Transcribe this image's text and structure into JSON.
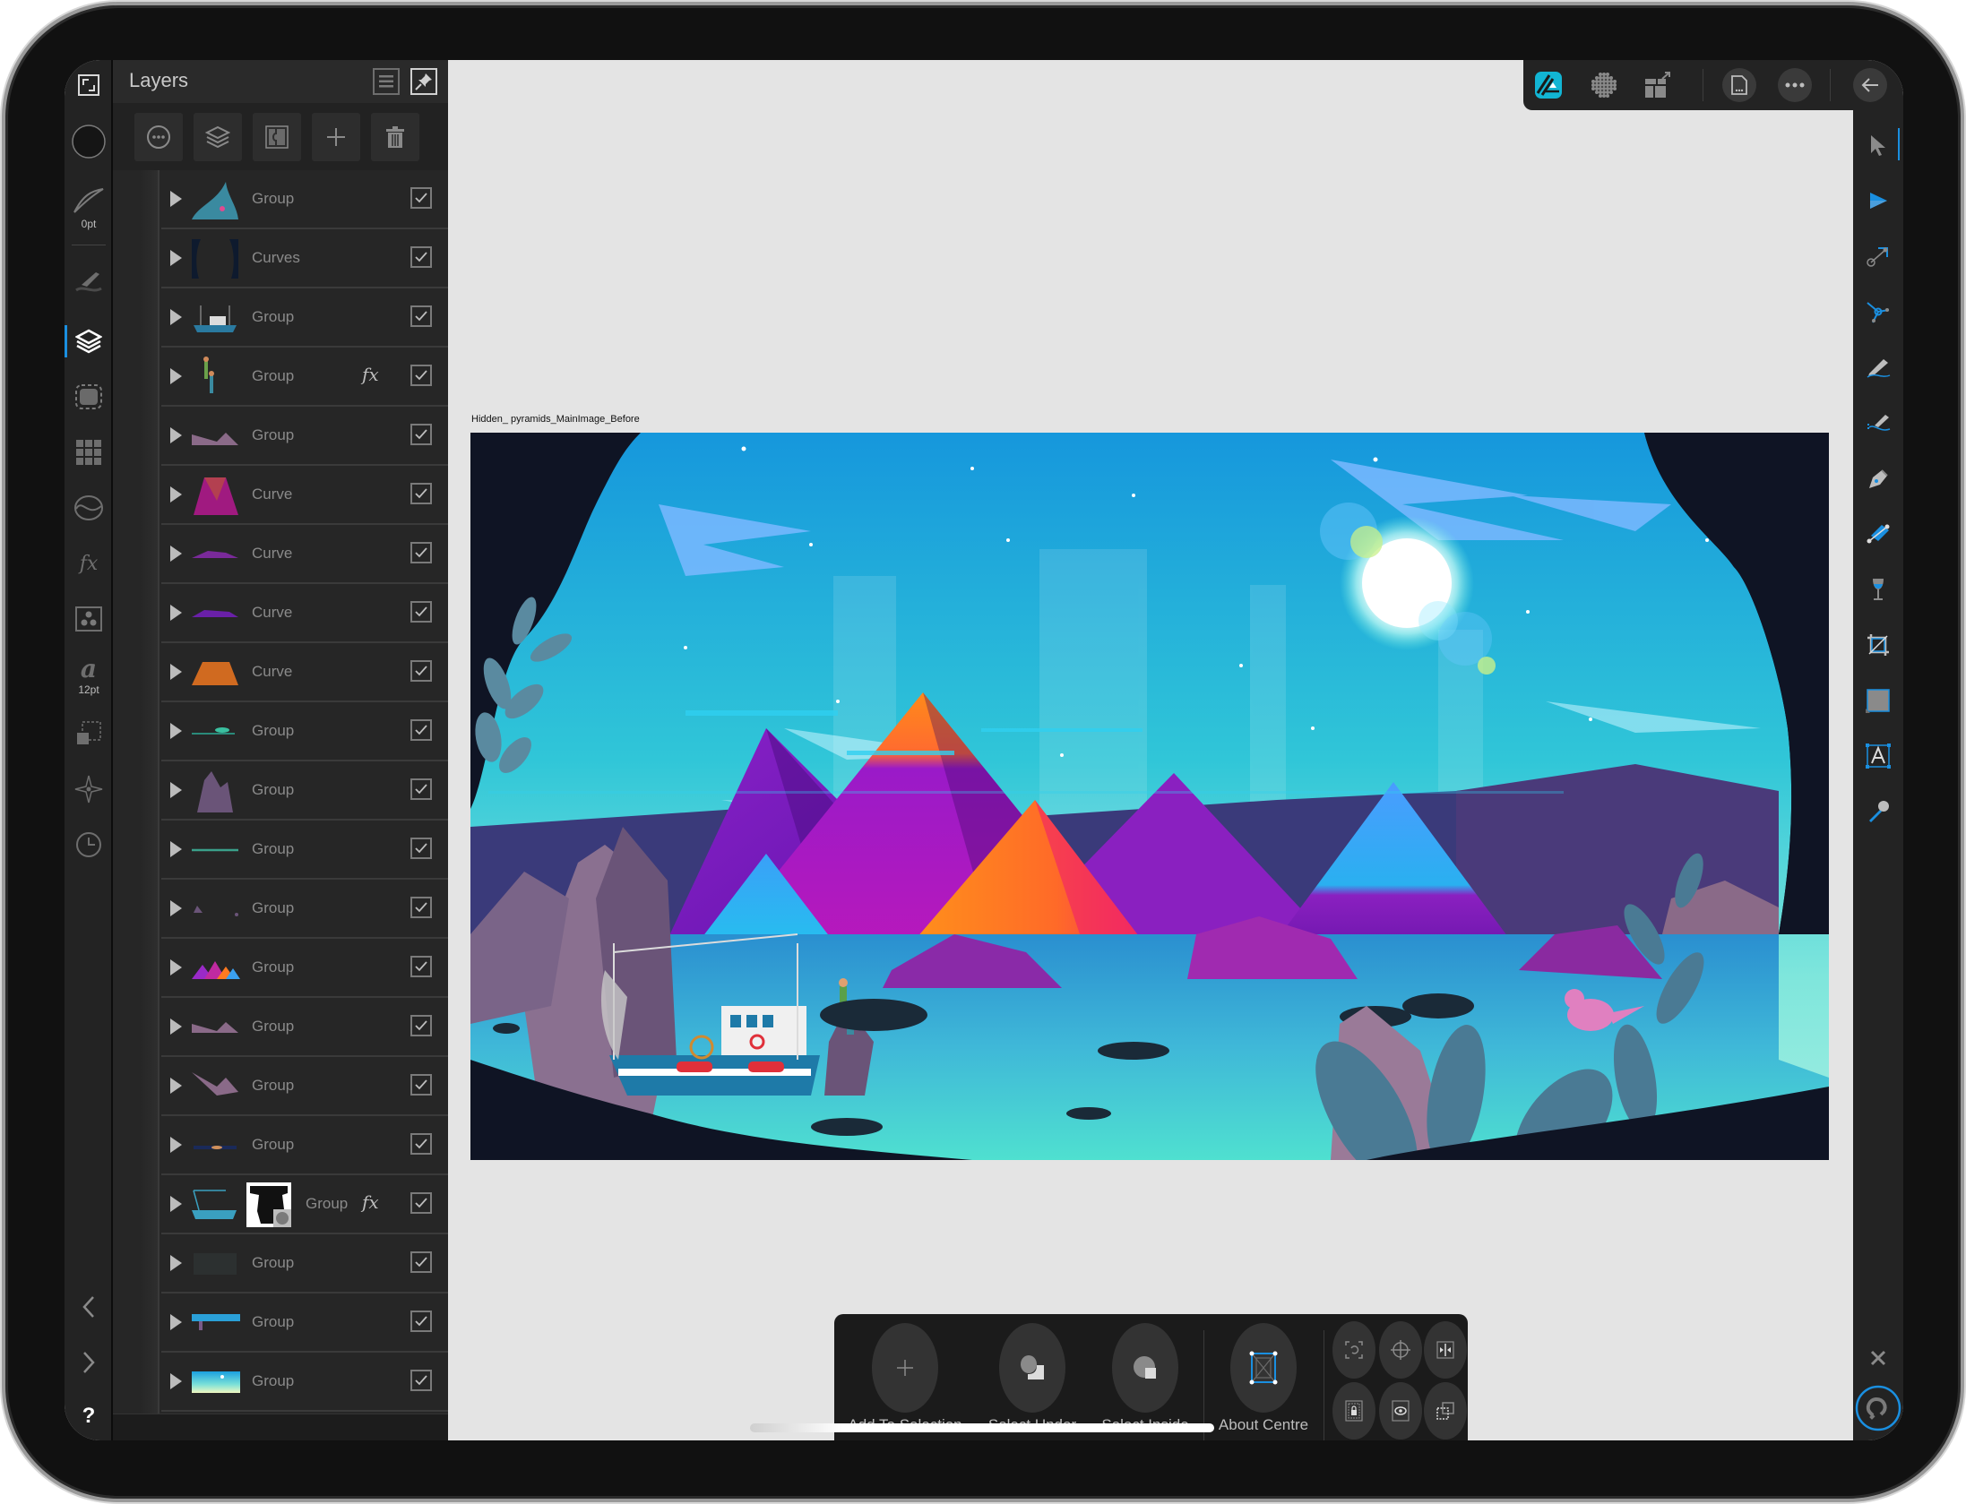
{
  "app": {
    "name": "Affinity Designer",
    "accent_color": "#1a8fe0",
    "logo_color": "#12b5d4"
  },
  "left_toolbar": {
    "items": [
      {
        "name": "fullscreen-icon",
        "label": ""
      },
      {
        "name": "color-swatch-icon",
        "label": ""
      },
      {
        "name": "stroke-width-icon",
        "label": "0pt"
      },
      {
        "name": "brush-studio-icon",
        "label": ""
      },
      {
        "name": "layers-studio-icon",
        "label": "",
        "active": true
      },
      {
        "name": "appearance-studio-icon",
        "label": ""
      },
      {
        "name": "swatches-studio-icon",
        "label": ""
      },
      {
        "name": "stroke-studio-icon",
        "label": ""
      },
      {
        "name": "effects-studio-icon",
        "label": ""
      },
      {
        "name": "styles-studio-icon",
        "label": ""
      },
      {
        "name": "text-studio-icon",
        "label": "12pt"
      },
      {
        "name": "transform-studio-icon",
        "label": ""
      },
      {
        "name": "navigator-studio-icon",
        "label": ""
      },
      {
        "name": "history-studio-icon",
        "label": ""
      }
    ],
    "bottom": {
      "prev_label": "‹",
      "next_label": "›",
      "help_label": "?"
    }
  },
  "layers_panel": {
    "title": "Layers",
    "toolbar_buttons": [
      "more-options",
      "layer-options",
      "mask-layer",
      "add-layer",
      "delete-layer"
    ],
    "layers": [
      {
        "name": "Group",
        "thumb": "leaves",
        "fx": false,
        "visible": true
      },
      {
        "name": "Curves",
        "thumb": "cave-frame",
        "fx": false,
        "visible": true
      },
      {
        "name": "Group",
        "thumb": "boat",
        "fx": false,
        "visible": true
      },
      {
        "name": "Group",
        "thumb": "people",
        "fx": true,
        "visible": true
      },
      {
        "name": "Group",
        "thumb": "rocks-pink",
        "fx": false,
        "visible": true
      },
      {
        "name": "Curve",
        "thumb": "rock-magenta",
        "fx": false,
        "visible": true
      },
      {
        "name": "Curve",
        "thumb": "rock-purple-flat",
        "fx": false,
        "visible": true
      },
      {
        "name": "Curve",
        "thumb": "rock-violet-flat",
        "fx": false,
        "visible": true
      },
      {
        "name": "Curve",
        "thumb": "rock-orange",
        "fx": false,
        "visible": true
      },
      {
        "name": "Group",
        "thumb": "reflection-teal",
        "fx": false,
        "visible": true
      },
      {
        "name": "Group",
        "thumb": "cliffs",
        "fx": false,
        "visible": true
      },
      {
        "name": "Group",
        "thumb": "line-teal",
        "fx": false,
        "visible": true
      },
      {
        "name": "Group",
        "thumb": "small-rocks",
        "fx": false,
        "visible": true
      },
      {
        "name": "Group",
        "thumb": "pyramids",
        "fx": false,
        "visible": true
      },
      {
        "name": "Group",
        "thumb": "rocks-pink-2",
        "fx": false,
        "visible": true
      },
      {
        "name": "Group",
        "thumb": "rocks-pink-3",
        "fx": false,
        "visible": true
      },
      {
        "name": "Group",
        "thumb": "horizon-dark",
        "fx": false,
        "visible": true
      },
      {
        "name": "Group",
        "thumb": "water-masked",
        "fx": true,
        "visible": true,
        "has_mask": true
      },
      {
        "name": "Group",
        "thumb": "faint",
        "fx": false,
        "visible": true
      },
      {
        "name": "Group",
        "thumb": "sea-strip",
        "fx": false,
        "visible": true
      },
      {
        "name": "Group",
        "thumb": "sky",
        "fx": false,
        "visible": true
      }
    ],
    "fx_label": "fx"
  },
  "canvas": {
    "document_label": "Hidden_ pyramids_MainImage_Before",
    "background": "#e4e4e4"
  },
  "top_toolbar": {
    "items": [
      "designer-persona-icon",
      "pixel-persona-icon",
      "export-persona-icon",
      "document-menu-icon",
      "more-menu-icon",
      "back-icon"
    ]
  },
  "right_toolbar": {
    "tools": [
      {
        "name": "move-tool-icon",
        "active": true
      },
      {
        "name": "node-tool-icon"
      },
      {
        "name": "point-transform-tool-icon"
      },
      {
        "name": "corner-tool-icon"
      },
      {
        "name": "pencil-tool-icon"
      },
      {
        "name": "vector-brush-tool-icon"
      },
      {
        "name": "pen-tool-icon"
      },
      {
        "name": "fill-tool-icon"
      },
      {
        "name": "transparency-tool-icon"
      },
      {
        "name": "crop-tool-icon"
      },
      {
        "name": "rectangle-tool-icon"
      },
      {
        "name": "artistic-text-tool-icon"
      },
      {
        "name": "color-picker-tool-icon"
      }
    ],
    "bottom": [
      "close-icon",
      "snapping-icon",
      "trash-icon"
    ]
  },
  "context_toolbar": {
    "buttons": [
      {
        "label": "Add To Selection",
        "icon": "plus-icon"
      },
      {
        "label": "Select Under",
        "icon": "select-under-icon"
      },
      {
        "label": "Select Inside",
        "icon": "select-inside-icon"
      },
      {
        "label": "About Centre",
        "icon": "about-centre-icon"
      }
    ],
    "small_buttons": [
      "rotate-icon",
      "target-icon",
      "align-icon",
      "lock-children-icon",
      "show-hidden-icon",
      "duplicate-icon"
    ]
  }
}
